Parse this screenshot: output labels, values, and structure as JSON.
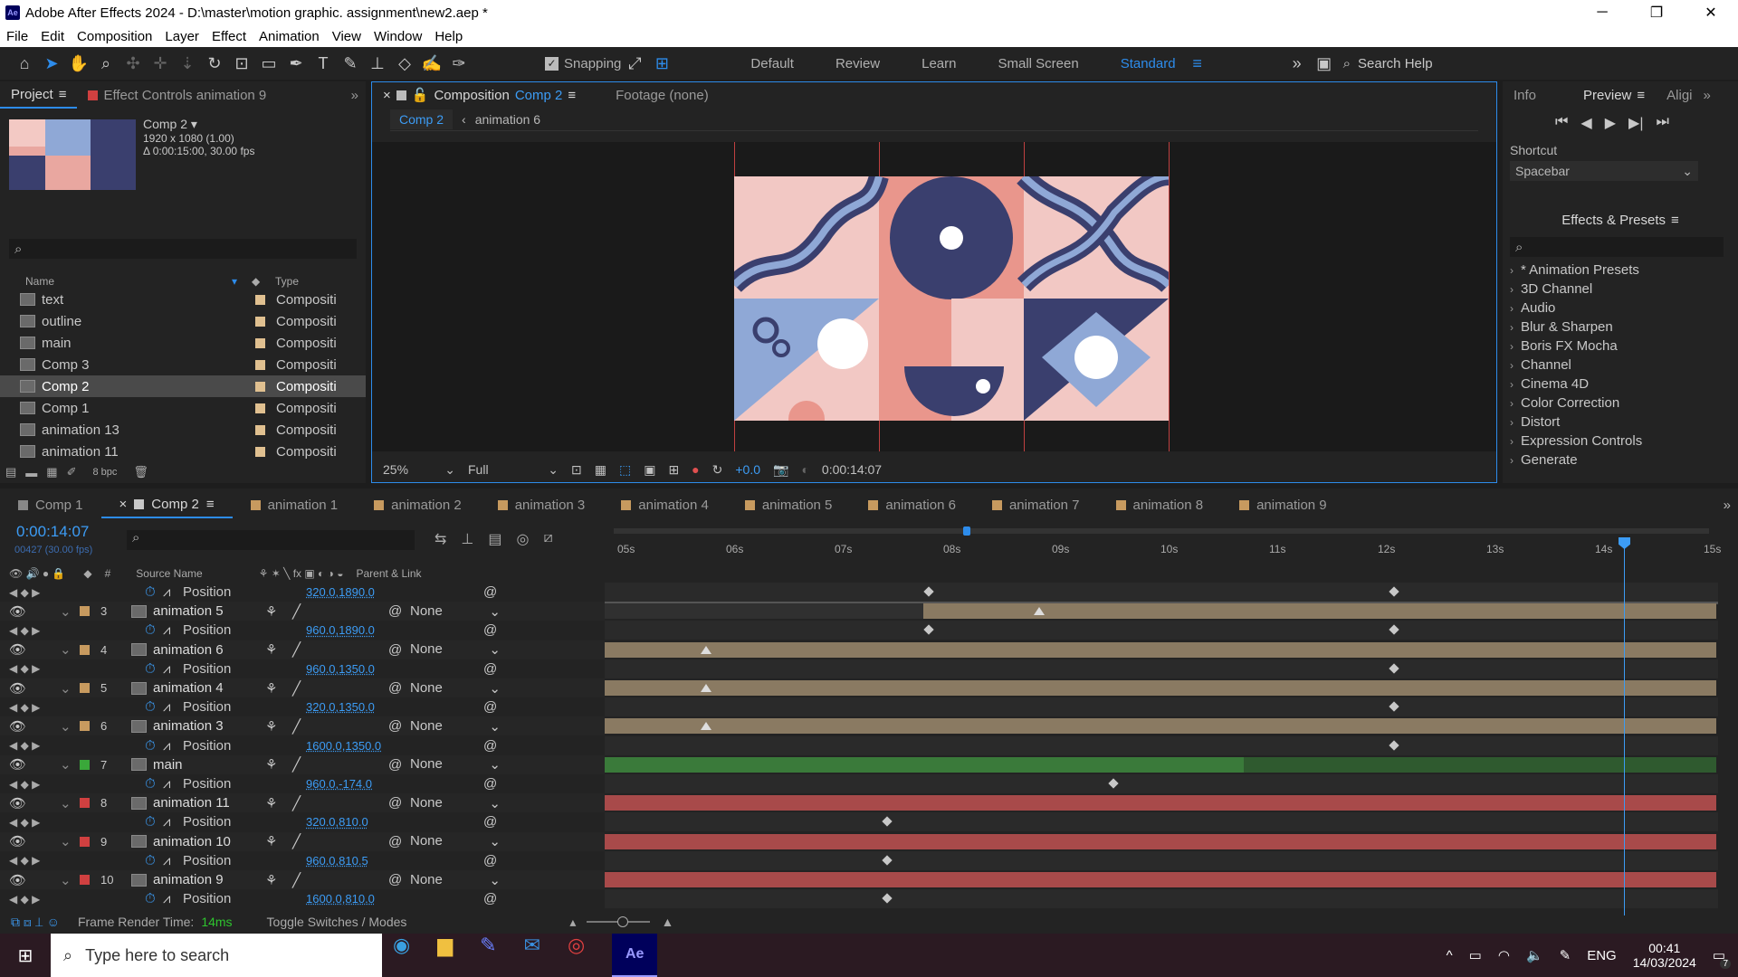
{
  "window": {
    "title": "Adobe After Effects 2024 - D:\\master\\motion graphic. assignment\\new2.aep *",
    "app_icon": "Ae"
  },
  "menu": [
    "File",
    "Edit",
    "Composition",
    "Layer",
    "Effect",
    "Animation",
    "View",
    "Window",
    "Help"
  ],
  "toolbar": {
    "snapping": "Snapping",
    "workspaces": [
      "Default",
      "Review",
      "Learn",
      "Small Screen",
      "Standard"
    ],
    "search": "Search Help"
  },
  "project": {
    "tab": "Project",
    "effect_tab": "Effect Controls animation 9",
    "comp_name": "Comp 2 ▾",
    "comp_size": "1920 x 1080 (1.00)",
    "comp_dur": "Δ 0:00:15:00, 30.00 fps",
    "col_name": "Name",
    "col_type": "Type",
    "bpc": "8 bpc",
    "items": [
      {
        "name": "text",
        "type": "Compositi"
      },
      {
        "name": "outline",
        "type": "Compositi"
      },
      {
        "name": "main",
        "type": "Compositi"
      },
      {
        "name": "Comp 3",
        "type": "Compositi"
      },
      {
        "name": "Comp 2",
        "type": "Compositi"
      },
      {
        "name": "Comp 1",
        "type": "Compositi"
      },
      {
        "name": "animation 13",
        "type": "Compositi"
      },
      {
        "name": "animation 11",
        "type": "Compositi"
      }
    ]
  },
  "viewer": {
    "tab_label": "Composition",
    "tab_comp": "Comp 2",
    "footage": "Footage (none)",
    "crumb1": "Comp 2",
    "crumb2": "animation 6",
    "zoom": "25%",
    "res": "Full",
    "exposure": "+0.0",
    "time": "0:00:14:07"
  },
  "preview": {
    "info": "Info",
    "preview": "Preview",
    "align": "Aligi",
    "shortcut_label": "Shortcut",
    "shortcut": "Spacebar"
  },
  "effects": {
    "title": "Effects & Presets",
    "items": [
      "* Animation Presets",
      "3D Channel",
      "Audio",
      "Blur & Sharpen",
      "Boris FX Mocha",
      "Channel",
      "Cinema 4D",
      "Color Correction",
      "Distort",
      "Expression Controls",
      "Generate"
    ]
  },
  "timeline": {
    "tabs": [
      "Comp 1",
      "Comp 2",
      "animation 1",
      "animation 2",
      "animation 3",
      "animation 4",
      "animation 5",
      "animation 6",
      "animation 7",
      "animation 8",
      "animation 9"
    ],
    "timecode": "0:00:14:07",
    "frames": "00427 (30.00 fps)",
    "col_source": "Source Name",
    "col_parent": "Parent & Link",
    "ruler": [
      "05s",
      "06s",
      "07s",
      "08s",
      "09s",
      "10s",
      "11s",
      "12s",
      "13s",
      "14s",
      "15s"
    ],
    "render_label": "Frame Render Time:",
    "render_time": "14ms",
    "toggle": "Toggle Switches / Modes",
    "rows": [
      {
        "kind": "prop",
        "name": "Position",
        "value": "320.0,1890.0"
      },
      {
        "kind": "layer",
        "num": "3",
        "name": "animation 5",
        "parent": "None",
        "color": "#c79a5f"
      },
      {
        "kind": "prop",
        "name": "Position",
        "value": "960.0,1890.0"
      },
      {
        "kind": "layer",
        "num": "4",
        "name": "animation 6",
        "parent": "None",
        "color": "#c79a5f"
      },
      {
        "kind": "prop",
        "name": "Position",
        "value": "960.0,1350.0"
      },
      {
        "kind": "layer",
        "num": "5",
        "name": "animation 4",
        "parent": "None",
        "color": "#c79a5f"
      },
      {
        "kind": "prop",
        "name": "Position",
        "value": "320.0,1350.0"
      },
      {
        "kind": "layer",
        "num": "6",
        "name": "animation 3",
        "parent": "None",
        "color": "#c79a5f"
      },
      {
        "kind": "prop",
        "name": "Position",
        "value": "1600.0,1350.0"
      },
      {
        "kind": "layer",
        "num": "7",
        "name": "main",
        "parent": "None",
        "color": "#3aa83a"
      },
      {
        "kind": "prop",
        "name": "Position",
        "value": "960.0,-174.0"
      },
      {
        "kind": "layer",
        "num": "8",
        "name": "animation 11",
        "parent": "None",
        "color": "#d04040"
      },
      {
        "kind": "prop",
        "name": "Position",
        "value": "320.0,810.0"
      },
      {
        "kind": "layer",
        "num": "9",
        "name": "animation 10",
        "parent": "None",
        "color": "#d04040"
      },
      {
        "kind": "prop",
        "name": "Position",
        "value": "960.0,810.5"
      },
      {
        "kind": "layer",
        "num": "10",
        "name": "animation 9",
        "parent": "None",
        "color": "#d04040"
      },
      {
        "kind": "prop",
        "name": "Position",
        "value": "1600.0,810.0"
      }
    ]
  },
  "taskbar": {
    "search": "Type here to search",
    "lang": "ENG",
    "time": "00:41",
    "date": "14/03/2024",
    "notif": "7"
  }
}
